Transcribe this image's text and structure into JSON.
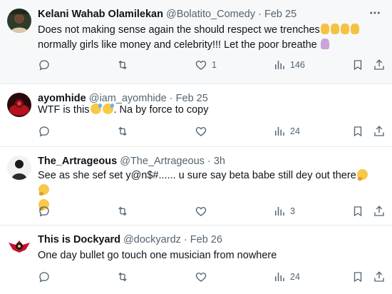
{
  "tweets": [
    {
      "name": "Kelani Wahab Olamilekan",
      "handle": "@Bolatito_Comedy",
      "dot": "·",
      "time": "Feb 25",
      "text_line1": "Does not making sense again the should respect we trenches",
      "text_line2": "normally girls like money and celebrity!!! Let the poor breathe",
      "line1_emojis": [
        "pray",
        "pray",
        "pray",
        "pray"
      ],
      "line2_emojis": [
        "woman"
      ],
      "replies": "",
      "retweets": "",
      "likes": "1",
      "views": "146"
    },
    {
      "name": "ayomhide",
      "handle": "@iam_ayomhide",
      "dot": "·",
      "time": "Feb 25",
      "text_before": "WTF is this",
      "text_after": ". Na by force to copy",
      "emojis": [
        "sweat",
        "sweat"
      ],
      "replies": "",
      "retweets": "",
      "likes": "",
      "views": "24"
    },
    {
      "name": "The_Artrageous",
      "handle": "@The_Artrageous",
      "dot": "·",
      "time": "3h",
      "text_line1": "See as she sef set y@n$#...... u sure say beta babe still dey out there",
      "line1_emojis": [
        "think",
        "think"
      ],
      "line2_emojis": [
        "think"
      ],
      "replies": "",
      "retweets": "",
      "likes": "",
      "views": "3"
    },
    {
      "name": "This is Dockyard",
      "handle": "@dockyardz",
      "dot": "·",
      "time": "Feb 26",
      "text_line1": "One day bullet go touch one musician from nowhere",
      "replies": "",
      "retweets": "",
      "likes": "",
      "views": "24"
    }
  ],
  "icons": {
    "more": "more-horizontal-icon",
    "reply": "reply-icon",
    "retweet": "retweet-icon",
    "like": "like-icon",
    "views": "views-icon",
    "bookmark": "bookmark-icon",
    "share": "share-icon"
  },
  "colors": {
    "text": "#0f1419",
    "muted": "#536471",
    "divider": "#e6e9ec",
    "highlight_bg": "#f7f8f9"
  }
}
